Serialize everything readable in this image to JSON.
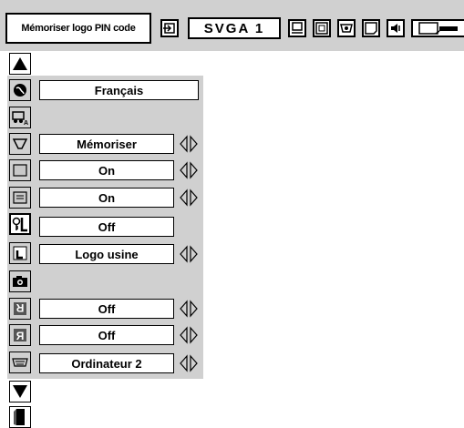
{
  "title": "Mémoriser logo PIN code",
  "toolbar": {
    "source": "SVGA 1",
    "icons": [
      "input-icon",
      "pc-adjust-icon",
      "image-select-icon",
      "image-adjust-icon",
      "screen-icon",
      "sound-icon",
      "setting-icon"
    ]
  },
  "menu": {
    "rows": [
      {
        "icon": "up-arrow-icon",
        "value": ""
      },
      {
        "icon": "language-globe-icon",
        "value": "Français",
        "arrows": false
      },
      {
        "icon": "auto-setup-icon",
        "value": ""
      },
      {
        "icon": "keystone-icon",
        "value": "Mémoriser",
        "arrows": true
      },
      {
        "icon": "blue-back-icon",
        "value": "On",
        "arrows": true
      },
      {
        "icon": "display-icon",
        "value": "On",
        "arrows": true
      },
      {
        "icon": "logo-pin-lock-icon",
        "value": "Off",
        "arrows": false
      },
      {
        "icon": "logo-select-icon",
        "value": "Logo usine",
        "arrows": true
      },
      {
        "icon": "logo-capture-icon",
        "value": ""
      },
      {
        "icon": "ceiling-icon",
        "value": "Off",
        "arrows": true
      },
      {
        "icon": "rear-icon",
        "value": "Off",
        "arrows": true
      },
      {
        "icon": "terminal-icon",
        "value": "Ordinateur 2",
        "arrows": true
      },
      {
        "icon": "down-arrow-icon",
        "value": ""
      },
      {
        "icon": "exit-door-icon",
        "value": ""
      }
    ]
  }
}
